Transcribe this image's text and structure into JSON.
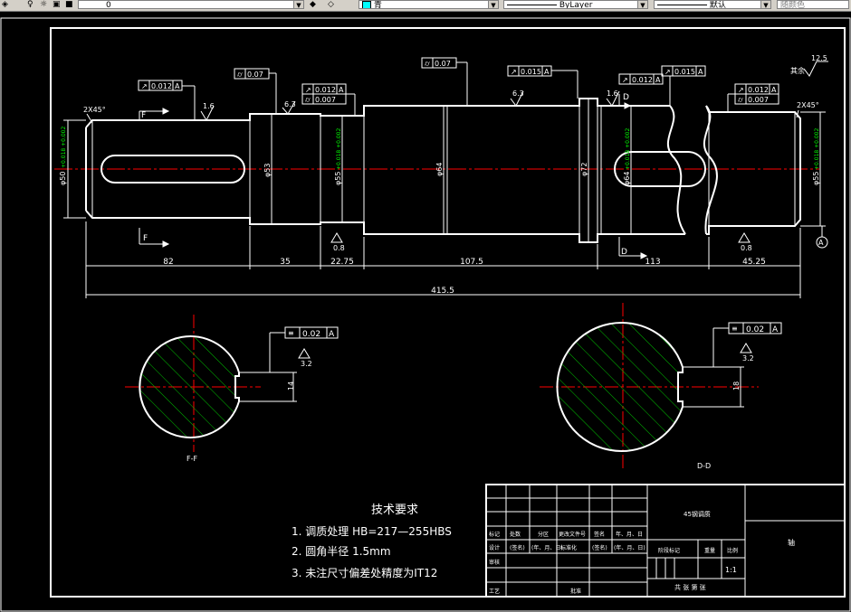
{
  "toolbar": {
    "layer_state": "0",
    "color_value": "青",
    "linetype_value": "ByLayer",
    "lineweight_value": "默认",
    "plotstyle_value": "随颜色"
  },
  "drawing": {
    "tolerances": {
      "f1": "0.012",
      "f1_ref": "A",
      "f2": "0.07",
      "f3": "0.012",
      "f3_ref": "A",
      "f4": "0.007",
      "f5": "0.07",
      "f6": "0.015",
      "f6_ref": "A",
      "f7": "0.012",
      "f7_ref": "A",
      "f8": "0.015",
      "f8_ref": "A",
      "f9": "0.012",
      "f9_ref": "A",
      "f10": "0.007",
      "sym_ff": "0.02",
      "sym_ff_ref": "A",
      "sym_dd": "0.02",
      "sym_dd_ref": "A"
    },
    "roughness": {
      "r1": "1.6",
      "r2": "6.3",
      "r3": "6.3",
      "r4": "1.6",
      "r5": "0.8",
      "r6": "0.8",
      "r7": "3.2",
      "r8": "3.2",
      "other": "12.5",
      "other_label": "其余"
    },
    "chamfer_left": "2X45°",
    "chamfer_right": "2X45°",
    "section_marks": {
      "f": "F",
      "d": "D"
    },
    "datum": "A",
    "dims": {
      "d1": "82",
      "d2": "35",
      "d3": "22.75",
      "d4": "107.5",
      "d5": "113",
      "d6": "45.25",
      "total": "415.5",
      "key_ff": "14",
      "key_dd": "18"
    },
    "diameters": {
      "dia1": "φ50",
      "dia1_tol": "+0.018\n+0.002",
      "dia2": "φ53",
      "dia3": "φ55",
      "dia3_tol": "+0.018\n+0.002",
      "dia4": "φ64",
      "dia5": "φ72",
      "dia6": "φ64",
      "dia6_tol": "+0.018\n+0.002",
      "dia7": "φ55",
      "dia7_tol": "+0.018\n+0.002"
    },
    "section_labels": {
      "ff": "F-F",
      "dd": "D-D"
    },
    "notes": {
      "title": "技术要求",
      "n1": "1. 调质处理 HB=217—255HBS",
      "n2": "2. 圆角半径  1.5mm",
      "n3": "3. 未注尺寸偏差处精度为IT12"
    },
    "title_block": {
      "material": "45钢调质",
      "part": "轴",
      "scale": "1:1",
      "h_mark": "标记",
      "h_count": "处数",
      "h_zone": "分区",
      "h_docno": "更改文件号",
      "h_sign": "签名",
      "h_date": "年、月、日",
      "h_design": "设计",
      "h_sig2": "(签名)",
      "h_date2": "(年、月、日)",
      "h_std": "标准化",
      "h_sig3": "(签名)",
      "h_date3": "(年、月、日)",
      "h_stage": "阶段标记",
      "h_weight": "重量",
      "h_scale": "比例",
      "h_check": "审核",
      "h_craft": "工艺",
      "h_approve": "批准",
      "sheets": "共 张 第 张"
    }
  }
}
